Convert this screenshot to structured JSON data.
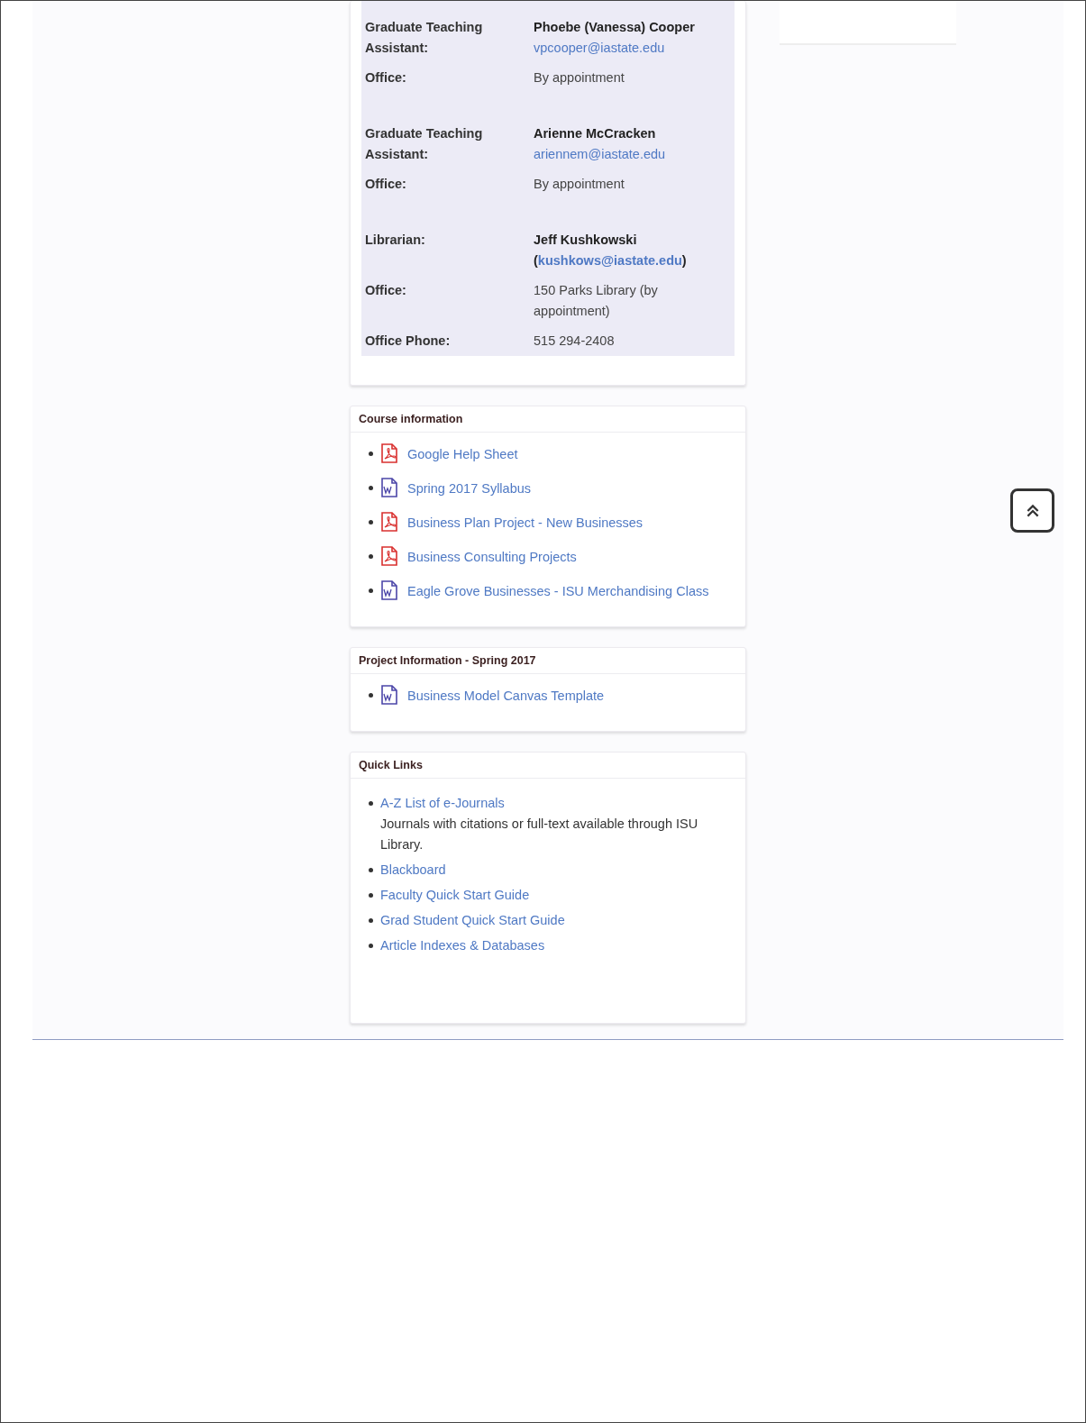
{
  "staff": [
    {
      "rows": [
        {
          "kind": "person",
          "label": "Graduate Teaching Assistant:",
          "name": "Phoebe (Vanessa) Cooper",
          "email": "vpcooper@iastate.edu"
        },
        {
          "kind": "text",
          "label": "Office:",
          "value": "By appointment"
        }
      ]
    },
    {
      "rows": [
        {
          "kind": "person",
          "label": "Graduate Teaching Assistant:",
          "name": "Arienne McCracken",
          "email": "ariennem@iastate.edu"
        },
        {
          "kind": "text",
          "label": "Office:",
          "value": "By appointment"
        }
      ]
    },
    {
      "rows": [
        {
          "kind": "person",
          "label": "Librarian:",
          "name": "Jeff Kushkowski",
          "open": "(",
          "email": "kushkows@iastate.edu",
          "close": ")"
        },
        {
          "kind": "text",
          "label": "Office:",
          "value": "150 Parks Library (by appointment)"
        },
        {
          "kind": "text",
          "label": "Office Phone:",
          "value": "515 294-2408"
        }
      ]
    }
  ],
  "course_information": {
    "title": "Course information",
    "files": [
      {
        "kind": "pdf",
        "label": "Google Help Sheet"
      },
      {
        "kind": "word",
        "label": "Spring 2017 Syllabus"
      },
      {
        "kind": "pdf",
        "label": "Business Plan Project - New Businesses"
      },
      {
        "kind": "pdf",
        "label": "Business Consulting Projects"
      },
      {
        "kind": "word",
        "label": "Eagle Grove Businesses - ISU Merchandising Class"
      }
    ]
  },
  "project_information": {
    "title": "Project Information - Spring 2017",
    "files": [
      {
        "kind": "word",
        "label": "Business Model Canvas Template"
      }
    ]
  },
  "quick_links": {
    "title": "Quick Links",
    "links": [
      {
        "label": "A-Z List of e-Journals",
        "description": "Journals with citations or full-text available through ISU Library."
      },
      {
        "label": "Blackboard"
      },
      {
        "label": "Faculty Quick Start Guide"
      },
      {
        "label": "Grad Student Quick Start Guide"
      },
      {
        "label": "Article Indexes & Databases"
      }
    ]
  }
}
